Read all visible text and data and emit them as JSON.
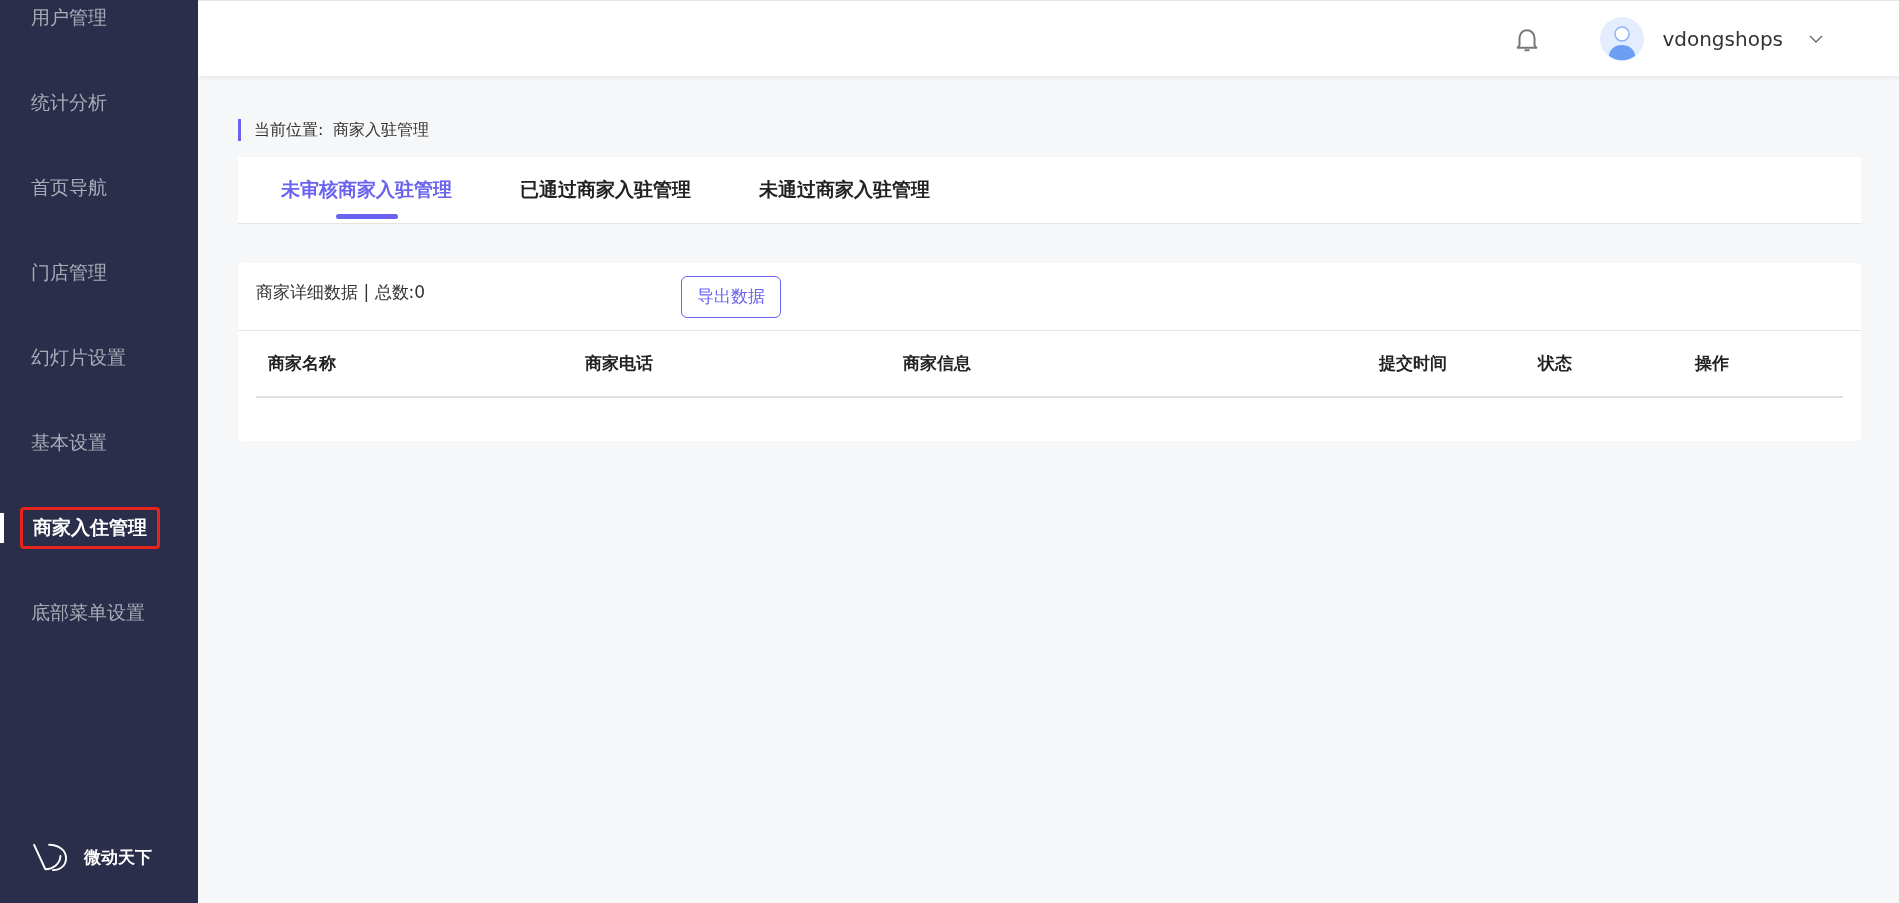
{
  "sidebar": {
    "items": [
      {
        "label": "用户管理",
        "selected": false
      },
      {
        "label": "统计分析",
        "selected": false
      },
      {
        "label": "首页导航",
        "selected": false
      },
      {
        "label": "门店管理",
        "selected": false
      },
      {
        "label": "幻灯片设置",
        "selected": false
      },
      {
        "label": "基本设置",
        "selected": false
      },
      {
        "label": "商家入住管理",
        "selected": true
      },
      {
        "label": "底部菜单设置",
        "selected": false
      }
    ],
    "brand": "微动天下"
  },
  "header": {
    "username": "vdongshops"
  },
  "breadcrumb": {
    "label": "当前位置:",
    "current": "商家入驻管理"
  },
  "tabs": [
    {
      "label": "未审核商家入驻管理",
      "selected": true
    },
    {
      "label": "已通过商家入驻管理",
      "selected": false
    },
    {
      "label": "未通过商家入驻管理",
      "selected": false
    }
  ],
  "panel": {
    "summary": "商家详细数据 | 总数:0",
    "export_button": "导出数据"
  },
  "table": {
    "columns": [
      "商家名称",
      "商家电话",
      "商家信息",
      "提交时间",
      "状态",
      "操作"
    ]
  }
}
